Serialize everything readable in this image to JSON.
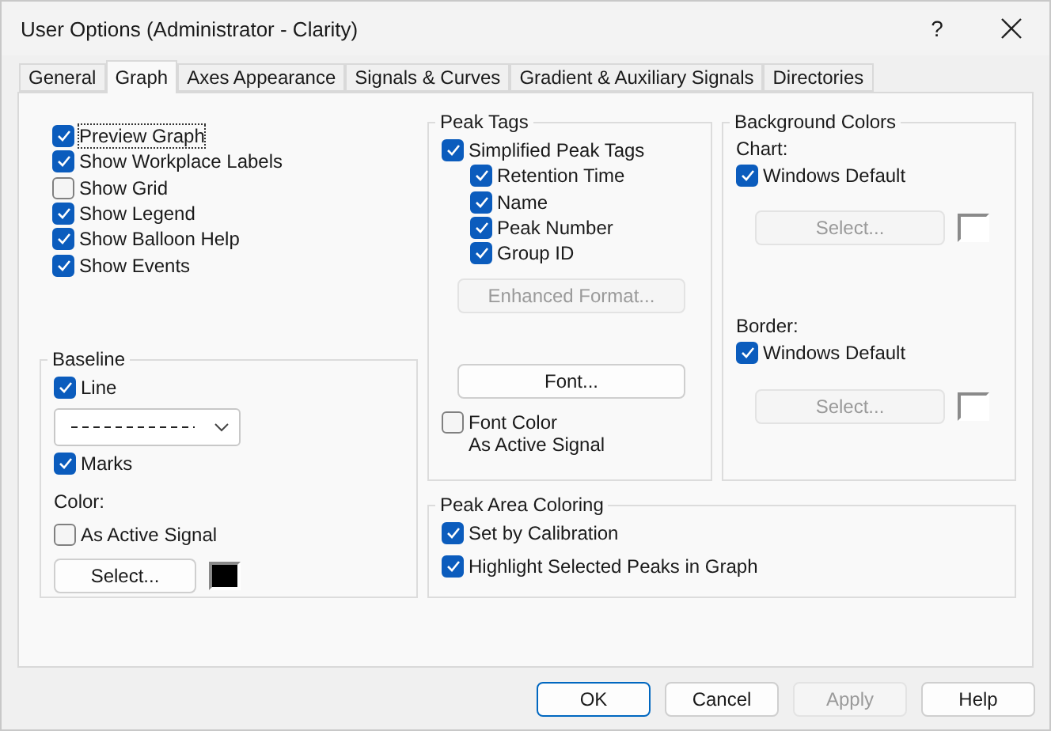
{
  "window": {
    "title": "User Options (Administrator - Clarity)",
    "help": "?"
  },
  "tabs": [
    {
      "label": "General",
      "selected": false
    },
    {
      "label": "Graph",
      "selected": true
    },
    {
      "label": "Axes Appearance",
      "selected": false
    },
    {
      "label": "Signals & Curves",
      "selected": false
    },
    {
      "label": "Gradient & Auxiliary Signals",
      "selected": false
    },
    {
      "label": "Directories",
      "selected": false
    }
  ],
  "display_options": [
    {
      "label": "Preview Graph",
      "checked": true,
      "focused": true
    },
    {
      "label": "Show Workplace Labels",
      "checked": true,
      "focused": false
    },
    {
      "label": "Show Grid",
      "checked": false,
      "focused": false
    },
    {
      "label": "Show Legend",
      "checked": true,
      "focused": false
    },
    {
      "label": "Show Balloon Help",
      "checked": true,
      "focused": false
    },
    {
      "label": "Show Events",
      "checked": true,
      "focused": false
    }
  ],
  "baseline": {
    "title": "Baseline",
    "line": {
      "label": "Line",
      "checked": true
    },
    "marks": {
      "label": "Marks",
      "checked": true
    },
    "color_label": "Color:",
    "as_active_signal": {
      "label": "As Active Signal",
      "checked": false
    },
    "select_button": {
      "label": "Select...",
      "disabled": false
    },
    "swatch": {
      "color": "#000000"
    }
  },
  "peak_tags": {
    "title": "Peak Tags",
    "simplified": {
      "label": "Simplified Peak Tags",
      "checked": true
    },
    "items": [
      {
        "label": "Retention Time",
        "checked": true
      },
      {
        "label": "Name",
        "checked": true
      },
      {
        "label": "Peak Number",
        "checked": true
      },
      {
        "label": "Group ID",
        "checked": true
      }
    ],
    "enhanced_button": {
      "label": "Enhanced Format...",
      "disabled": true
    },
    "font_button": {
      "label": "Font...",
      "disabled": false
    },
    "font_color": {
      "label_lines": [
        "Font Color",
        "As Active Signal"
      ],
      "checked": false
    }
  },
  "background_colors": {
    "title": "Background Colors",
    "sections": [
      {
        "label": "Chart:",
        "windows_default": {
          "label": "Windows Default",
          "checked": true
        },
        "select_button": {
          "label": "Select...",
          "disabled": true
        },
        "swatch": {
          "color": "#ffffff"
        }
      },
      {
        "label": "Border:",
        "windows_default": {
          "label": "Windows Default",
          "checked": true
        },
        "select_button": {
          "label": "Select...",
          "disabled": true
        },
        "swatch": {
          "color": "#ffffff"
        }
      }
    ]
  },
  "peak_area_coloring": {
    "title": "Peak Area Coloring",
    "items": [
      {
        "label": "Set by Calibration",
        "checked": true
      },
      {
        "label": "Highlight Selected Peaks in Graph",
        "checked": true
      }
    ]
  },
  "buttons": [
    {
      "label": "OK",
      "kind": "default",
      "disabled": false
    },
    {
      "label": "Cancel",
      "kind": "normal",
      "disabled": false
    },
    {
      "label": "Apply",
      "kind": "normal",
      "disabled": true
    },
    {
      "label": "Help",
      "kind": "normal",
      "disabled": false
    }
  ]
}
